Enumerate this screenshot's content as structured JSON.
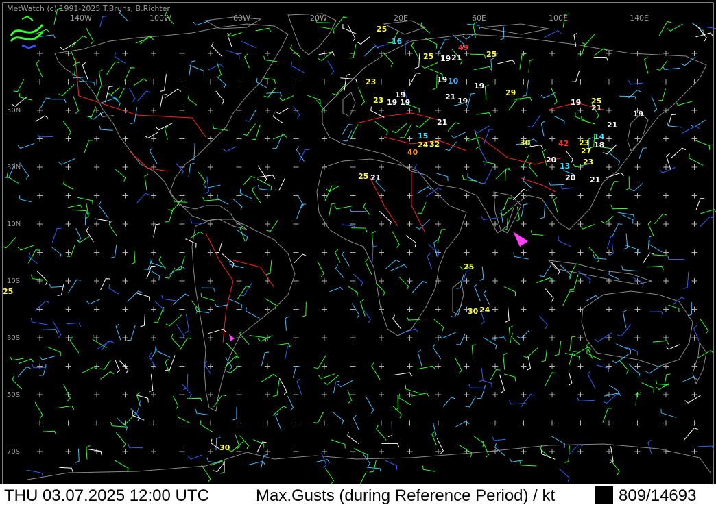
{
  "header": {
    "copyright": "MetWatch  (c) 1991-2025 T.Bruns, B.Richter"
  },
  "longitude_labels": [
    {
      "text": "140W",
      "col": 1
    },
    {
      "text": "100W",
      "col": 3
    },
    {
      "text": "60W",
      "col": 5
    },
    {
      "text": "20W",
      "col": 7
    },
    {
      "text": "20E",
      "col": 9
    },
    {
      "text": "60E",
      "col": 11
    },
    {
      "text": "100E",
      "col": 13
    },
    {
      "text": "140E",
      "col": 15
    }
  ],
  "latitude_labels": [
    {
      "text": "50N",
      "row": 1
    },
    {
      "text": "30N",
      "row": 2
    },
    {
      "text": "10N",
      "row": 3
    },
    {
      "text": "10S",
      "row": 4
    },
    {
      "text": "30S",
      "row": 5
    },
    {
      "text": "50S",
      "row": 6
    },
    {
      "text": "70S",
      "row": 7
    }
  ],
  "gust_values": [
    {
      "v": "25",
      "c": "#ffff40"
    },
    {
      "v": "16",
      "c": "#40e0ff"
    },
    {
      "v": "49",
      "c": "#ff3030"
    },
    {
      "v": "25",
      "c": "#ffff40"
    },
    {
      "v": "19",
      "c": "#ffffff"
    },
    {
      "v": "21",
      "c": "#ffffff"
    },
    {
      "v": "25",
      "c": "#ffff40"
    },
    {
      "v": "19",
      "c": "#ffffff"
    },
    {
      "v": "10",
      "c": "#40b0ff"
    },
    {
      "v": "19",
      "c": "#ffffff"
    },
    {
      "v": "23",
      "c": "#ffff40"
    },
    {
      "v": "19",
      "c": "#ffffff"
    },
    {
      "v": "21",
      "c": "#ffffff"
    },
    {
      "v": "19",
      "c": "#ffffff"
    },
    {
      "v": "29",
      "c": "#ffff40"
    },
    {
      "v": "23",
      "c": "#ffff40"
    },
    {
      "v": "19",
      "c": "#ffffff"
    },
    {
      "v": "19",
      "c": "#ffffff"
    },
    {
      "v": "19",
      "c": "#ffffff"
    },
    {
      "v": "25",
      "c": "#ffff40"
    },
    {
      "v": "21",
      "c": "#ffffff"
    },
    {
      "v": "19",
      "c": "#ffffff"
    },
    {
      "v": "21",
      "c": "#ffffff"
    },
    {
      "v": "21",
      "c": "#ffffff"
    },
    {
      "v": "15",
      "c": "#40e0ff"
    },
    {
      "v": "24",
      "c": "#ffff40"
    },
    {
      "v": "32",
      "c": "#ffff40"
    },
    {
      "v": "40",
      "c": "#ff9020"
    },
    {
      "v": "30",
      "c": "#ffff40"
    },
    {
      "v": "42",
      "c": "#ff3030"
    },
    {
      "v": "23",
      "c": "#ffff40"
    },
    {
      "v": "18",
      "c": "#ffffff"
    },
    {
      "v": "14",
      "c": "#40e0ff"
    },
    {
      "v": "27",
      "c": "#ffff40"
    },
    {
      "v": "20",
      "c": "#ffffff"
    },
    {
      "v": "13",
      "c": "#40e0ff"
    },
    {
      "v": "23",
      "c": "#ffff40"
    },
    {
      "v": "25",
      "c": "#ffff40"
    },
    {
      "v": "21",
      "c": "#ffffff"
    },
    {
      "v": "20",
      "c": "#ffffff"
    },
    {
      "v": "21",
      "c": "#ffffff"
    },
    {
      "v": "25",
      "c": "#ffff40"
    },
    {
      "v": "25",
      "c": "#ffff40"
    },
    {
      "v": "30",
      "c": "#ffff40"
    },
    {
      "v": "24",
      "c": "#ffff40"
    },
    {
      "v": "30",
      "c": "#ffff40"
    }
  ],
  "footer": {
    "datetime": "THU 03.07.2025 12:00 UTC",
    "parameter": "Max.Gusts (during Reference Period) / kt",
    "count": "809/14693"
  },
  "colors": {
    "coast": "#8a8a8a",
    "border": "#ff2020",
    "river": "#2040ff",
    "grid": "#b0b0b0"
  }
}
